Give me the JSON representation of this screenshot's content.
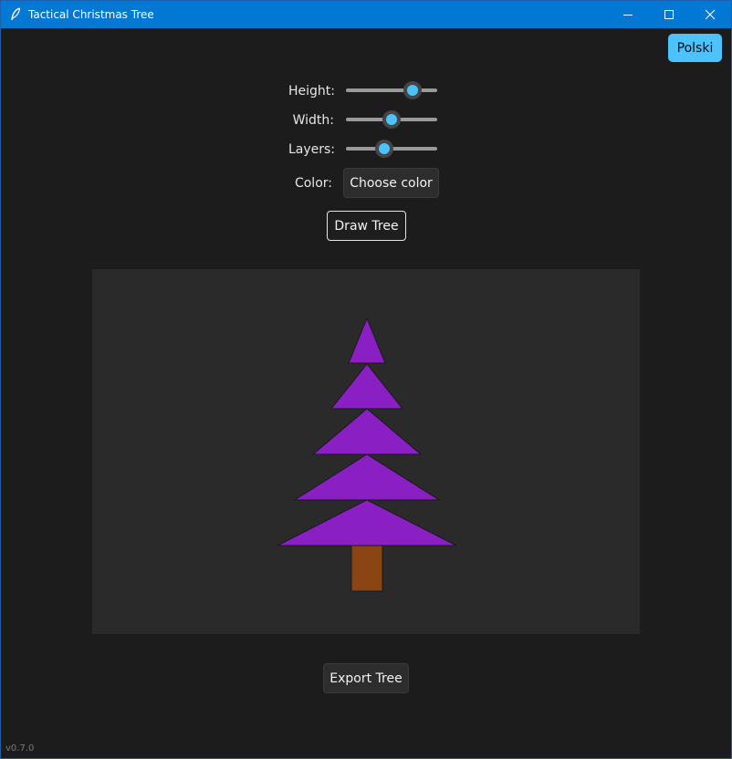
{
  "window": {
    "title": "Tactical Christmas Tree",
    "accent_color": "#0078d4"
  },
  "language_button": {
    "label": "Polski",
    "color": "#4cc2ff"
  },
  "controls": {
    "height": {
      "label": "Height:",
      "level": 0.73
    },
    "width": {
      "label": "Width:",
      "level": 0.5
    },
    "layers": {
      "label": "Layers:",
      "level": 0.42
    },
    "color": {
      "label": "Color:",
      "button_label": "Choose color"
    }
  },
  "draw_button": {
    "label": "Draw Tree"
  },
  "tree": {
    "layers": 5,
    "foliage_color": "#8a1fc4",
    "trunk_color": "#8b4513"
  },
  "export_button": {
    "label": "Export Tree"
  },
  "version": "v0.7.0"
}
